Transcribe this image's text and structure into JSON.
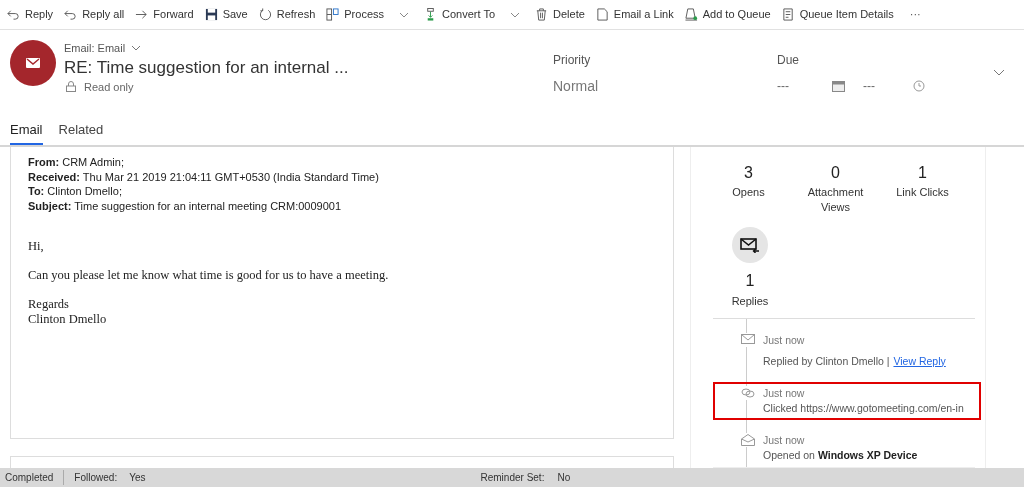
{
  "toolbar": [
    {
      "label": "Reply",
      "kind": "reply",
      "dropdown": false
    },
    {
      "label": "Reply all",
      "kind": "reply",
      "dropdown": false
    },
    {
      "label": "Forward",
      "kind": "forward",
      "dropdown": false
    },
    {
      "label": "Save",
      "kind": "save",
      "dropdown": false
    },
    {
      "label": "Refresh",
      "kind": "refresh",
      "dropdown": false
    },
    {
      "label": "Process",
      "kind": "process",
      "dropdown": true
    },
    {
      "label": "Convert To",
      "kind": "convert",
      "dropdown": true
    },
    {
      "label": "Delete",
      "kind": "delete",
      "dropdown": false
    },
    {
      "label": "Email a Link",
      "kind": "doc",
      "dropdown": false
    },
    {
      "label": "Add to Queue",
      "kind": "queue",
      "dropdown": false
    },
    {
      "label": "Queue Item Details",
      "kind": "details",
      "dropdown": false
    }
  ],
  "more": "···",
  "header": {
    "entity": "Email: Email",
    "title": "RE: Time suggestion for an internal ...",
    "read_only": "Read only",
    "priority": {
      "label": "Priority",
      "value": "Normal"
    },
    "due": {
      "label": "Due",
      "date": "---",
      "time": "---"
    }
  },
  "tabs": [
    {
      "label": "Email",
      "selected": true
    },
    {
      "label": "Related",
      "selected": false
    }
  ],
  "message": {
    "fields": [
      {
        "label": "From:",
        "value": "CRM Admin;"
      },
      {
        "label": "Received:",
        "value": "Thu Mar 21 2019 21:04:11 GMT+0530 (India Standard Time)"
      },
      {
        "label": "To:",
        "value": "Clinton Dmello;"
      },
      {
        "label": "Subject:",
        "value": "Time suggestion for an internal meeting CRM:0009001"
      }
    ],
    "body": [
      "Hi,",
      "Can you please let me know what time is good for us to have a meeting.",
      "Regards\nClinton Dmello"
    ]
  },
  "stats": [
    {
      "value": "3",
      "label": "Opens"
    },
    {
      "value": "0",
      "label": "Attachment Views"
    },
    {
      "value": "1",
      "label": "Link Clicks"
    }
  ],
  "replies": {
    "value": "1",
    "label": "Replies"
  },
  "timeline": [
    {
      "kind": "reply",
      "time": "Just now",
      "text": "Replied by Clinton Dmello |",
      "link": "View Reply",
      "highlighted": false
    },
    {
      "kind": "click",
      "time": "Just now",
      "text": "Clicked https://www.gotomeeting.com/en-in",
      "highlighted": true
    },
    {
      "kind": "open",
      "time": "Just now",
      "text": "Opened on **Windows XP Device**",
      "highlighted": false
    }
  ],
  "status_bar": {
    "state": "Completed",
    "followed_label": "Followed:",
    "followed": "Yes",
    "reminder_label": "Reminder Set:",
    "reminder": "No"
  }
}
